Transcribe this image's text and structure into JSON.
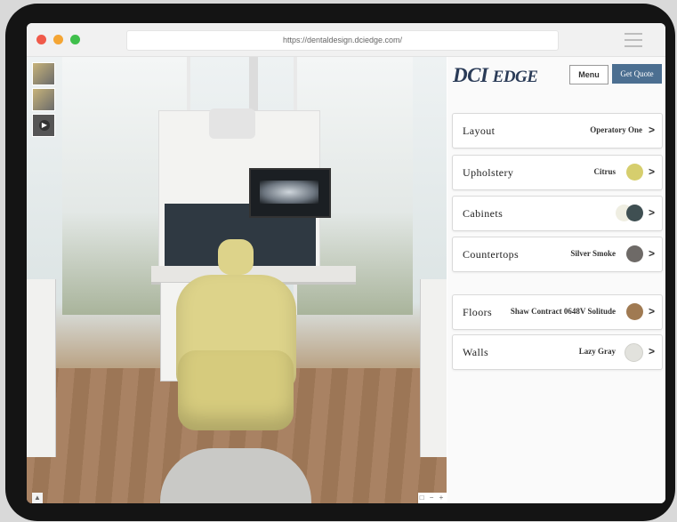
{
  "browser": {
    "url": "https://dentaldesign.dciedge.com/"
  },
  "brand": {
    "logo": "DCI EDGE"
  },
  "header": {
    "menu_label": "Menu",
    "quote_label": "Get Quote"
  },
  "options": [
    {
      "label": "Layout",
      "value": "Operatory One",
      "color": null
    },
    {
      "label": "Upholstery",
      "value": "Citrus",
      "color": "#d6ce6d"
    },
    {
      "label": "Cabinets",
      "value": "",
      "color": "#3f4f52"
    },
    {
      "label": "Countertops",
      "value": "Silver Smoke",
      "color": "#6e6a67"
    },
    {
      "label": "Floors",
      "value": "Shaw Contract 0648V Solitude",
      "color": "#a07a52"
    },
    {
      "label": "Walls",
      "value": "Lazy Gray",
      "color": "#e2e2dd"
    }
  ],
  "viewer": {
    "zoom_controls": "□ − +"
  },
  "colors": {
    "accent": "#4c6f91",
    "logo": "#2a3b57"
  }
}
